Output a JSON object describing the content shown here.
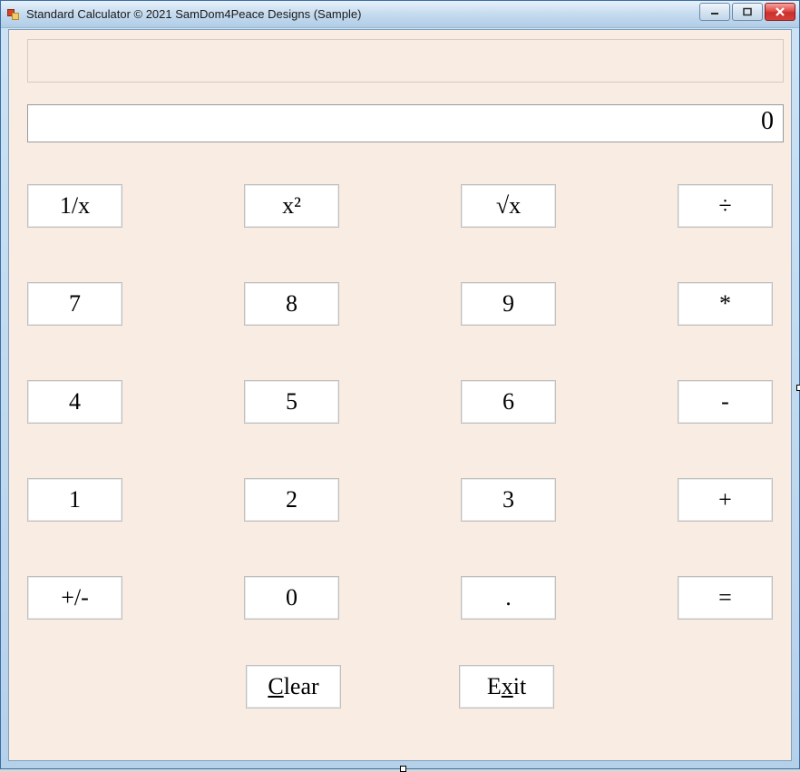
{
  "window": {
    "title": "Standard Calculator © 2021 SamDom4Peace Designs (Sample)"
  },
  "display": {
    "expression": "",
    "value": "0"
  },
  "buttons": {
    "r0": {
      "c0": "1/x",
      "c1": "x²",
      "c2": "√x",
      "c3": "÷"
    },
    "r1": {
      "c0": "7",
      "c1": "8",
      "c2": "9",
      "c3": "*"
    },
    "r2": {
      "c0": "4",
      "c1": "5",
      "c2": "6",
      "c3": "-"
    },
    "r3": {
      "c0": "1",
      "c1": "2",
      "c2": "3",
      "c3": "+"
    },
    "r4": {
      "c0": "+/-",
      "c1": "0",
      "c2": ".",
      "c3": "="
    },
    "clear_prefix": "C",
    "clear_suffix": "lear",
    "exit_prefix": "E",
    "exit_mid": "x",
    "exit_suffix": "it"
  }
}
